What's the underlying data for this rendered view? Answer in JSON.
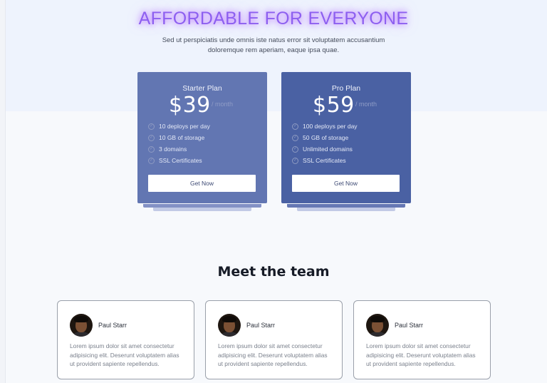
{
  "hero": {
    "title": "AFFORDABLE FOR EVERYONE",
    "subtitle": "Sed ut perspiciatis unde omnis iste natus error sit voluptatem accusantium doloremque rem aperiam, eaque ipsa quae."
  },
  "plans": [
    {
      "name": "Starter Plan",
      "price": "$39",
      "period": "/ month",
      "features": [
        "10 deploys per day",
        "10 GB of storage",
        "3 domains",
        "SSL Certificates"
      ],
      "cta": "Get Now",
      "color": "#6276b2"
    },
    {
      "name": "Pro Plan",
      "price": "$59",
      "period": "/ month",
      "features": [
        "100 deploys per day",
        "50 GB of storage",
        "Unlimited domains",
        "SSL Certificates"
      ],
      "cta": "Get Now",
      "color": "#4a61a3"
    }
  ],
  "team": {
    "title": "Meet the team",
    "members": [
      {
        "name": "Paul Starr",
        "bio": "Lorem ipsum dolor sit amet consectetur adipisicing elit. Deserunt voluptatem alias ut provident sapiente repellendus."
      },
      {
        "name": "Paul Starr",
        "bio": "Lorem ipsum dolor sit amet consectetur adipisicing elit. Deserunt voluptatem alias ut provident sapiente repellendus."
      },
      {
        "name": "Paul Starr",
        "bio": "Lorem ipsum dolor sit amet consectetur adipisicing elit. Deserunt voluptatem alias ut provident sapiente repellendus."
      }
    ]
  },
  "icons": {
    "feature": "check-circle-icon",
    "avatar": "user-photo"
  },
  "colors": {
    "title_glow": "#b76eff",
    "stack_light": "#b9c2e0"
  }
}
